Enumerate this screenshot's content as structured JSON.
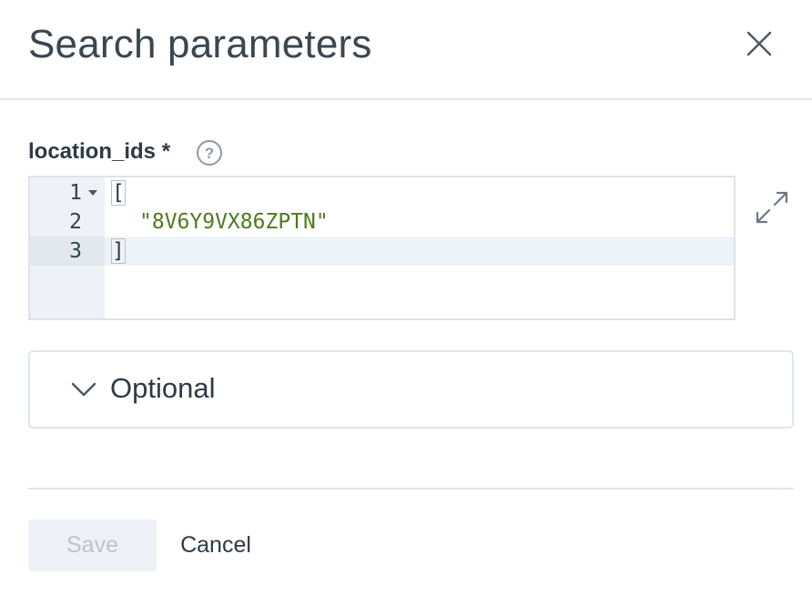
{
  "dialog": {
    "title": "Search parameters",
    "close_icon": "close-icon"
  },
  "field": {
    "label": "location_ids *",
    "help_icon": "help-icon",
    "expand_icon": "expand-icon"
  },
  "editor": {
    "lines": [
      {
        "number": "1",
        "text": "["
      },
      {
        "number": "2",
        "text": "\"8V6Y9VX86ZPTN\""
      },
      {
        "number": "3",
        "text": "]"
      }
    ],
    "active_line": "3"
  },
  "optional": {
    "label": "Optional",
    "icon": "chevron-down-icon",
    "expanded": false
  },
  "footer": {
    "save_label": "Save",
    "save_disabled": true,
    "cancel_label": "Cancel"
  },
  "colors": {
    "string": "#4e7a1e",
    "text": "#2d3a46",
    "divider": "#dfe6ec",
    "disabled_text": "#b8c4cf"
  }
}
